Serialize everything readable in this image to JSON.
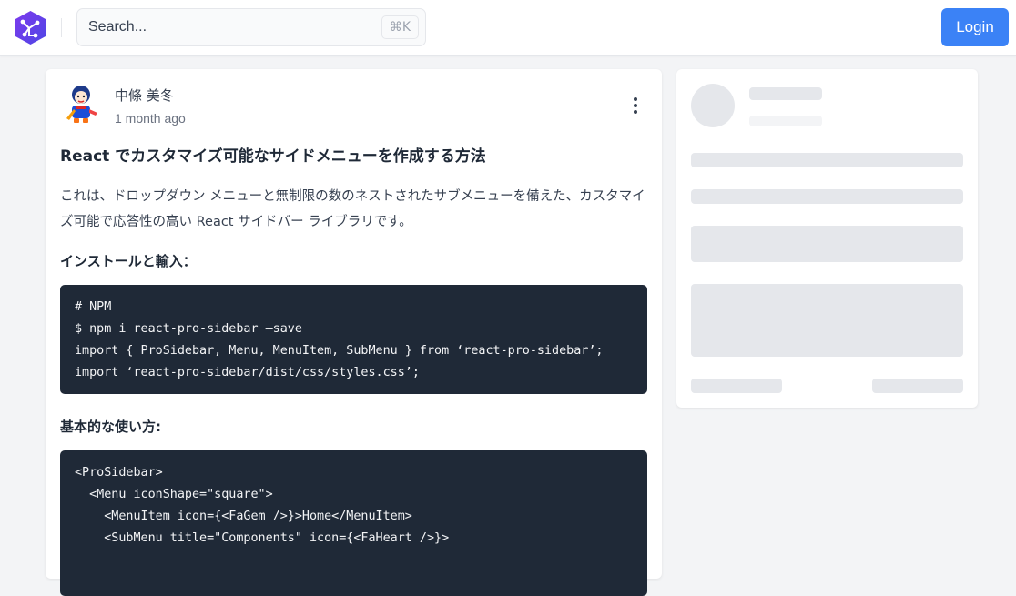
{
  "header": {
    "logo_icon": "hexagon-circuit-icon",
    "search": {
      "placeholder": "Search...",
      "shortcut": "⌘K"
    },
    "login_label": "Login",
    "accent_color": "#3b82f6"
  },
  "post": {
    "author": "中條 美冬",
    "time": "1 month ago",
    "menu_icon": "more-vertical-icon",
    "title": "React でカスタマイズ可能なサイドメニューを作成する方法",
    "intro": "これは、ドロップダウン メニューと無制限の数のネストされたサブメニューを備えた、カスタマイズ可能で応答性の高い React サイドバー ライブラリです。",
    "install_heading": "インストールと輸入：",
    "install_code": [
      "# NPM",
      "$ npm i react-pro-sidebar —save",
      "import { ProSidebar, Menu, MenuItem, SubMenu } from ‘react-pro-sidebar’;",
      "import ‘react-pro-sidebar/dist/css/styles.css’;"
    ],
    "usage_heading": "基本的な使い方:",
    "usage_code": [
      "<ProSidebar>",
      "  <Menu iconShape=\"square\">",
      "    <MenuItem icon={<FaGem />}>Home</MenuItem>",
      "    <SubMenu title=\"Components\" icon={<FaHeart />}>"
    ]
  },
  "sidebar_placeholder": {
    "state": "loading-skeleton"
  }
}
